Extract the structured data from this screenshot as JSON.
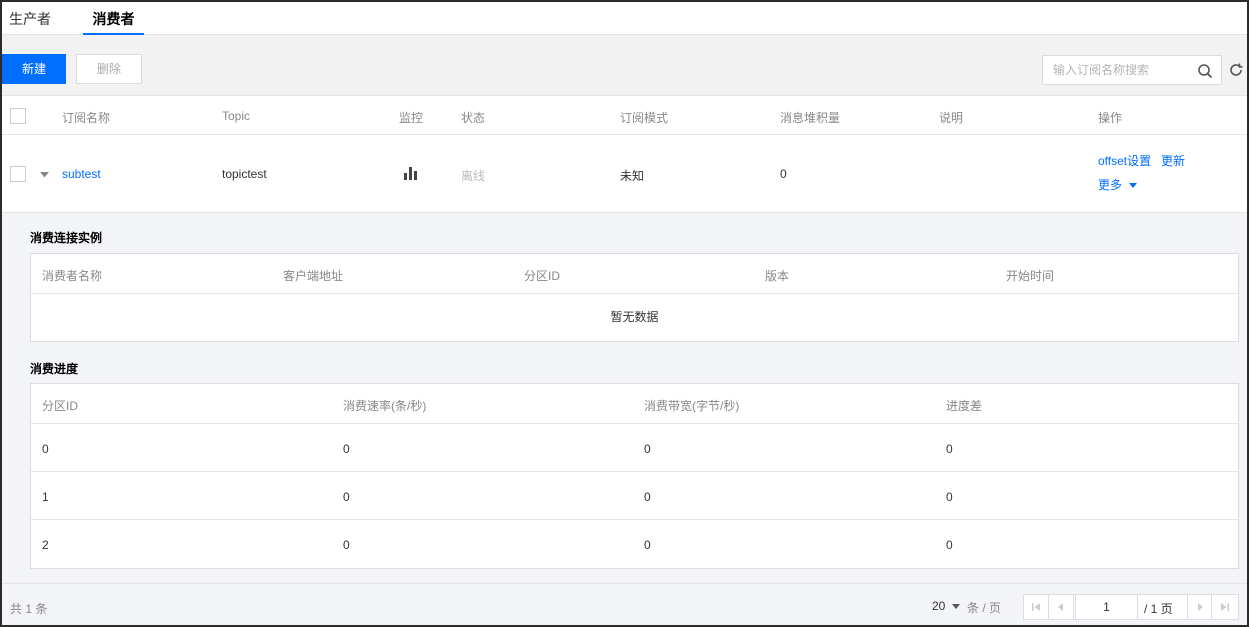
{
  "tabs": [
    {
      "label": "生产者"
    },
    {
      "label": "消费者"
    }
  ],
  "toolbar": {
    "new_label": "新建",
    "delete_label": "删除",
    "search_placeholder": "输入订阅名称搜索"
  },
  "table": {
    "headers": [
      "订阅名称",
      "Topic",
      "监控",
      "状态",
      "订阅模式",
      "消息堆积量",
      "说明",
      "操作"
    ],
    "rows": [
      {
        "name": "subtest",
        "topic": "topictest",
        "status": "离线",
        "mode": "未知",
        "backlog": "0",
        "actions": {
          "offset": "offset设置",
          "update": "更新",
          "more": "更多"
        }
      }
    ]
  },
  "instances": {
    "title": "消费连接实例",
    "headers": [
      "消费者名称",
      "客户端地址",
      "分区ID",
      "版本",
      "开始时间"
    ],
    "empty": "暂无数据"
  },
  "progress": {
    "title": "消费进度",
    "headers": [
      "分区ID",
      "消费速率(条/秒)",
      "消费带宽(字节/秒)",
      "进度差"
    ],
    "rows": [
      [
        "0",
        "0",
        "0",
        "0"
      ],
      [
        "1",
        "0",
        "0",
        "0"
      ],
      [
        "2",
        "0",
        "0",
        "0"
      ]
    ]
  },
  "footer": {
    "total": "共 1 条",
    "page_size": "20",
    "per_page": "条 / 页",
    "current_page": "1",
    "total_pages": "/ 1 页"
  },
  "colors": {
    "accent": "#006eff"
  }
}
